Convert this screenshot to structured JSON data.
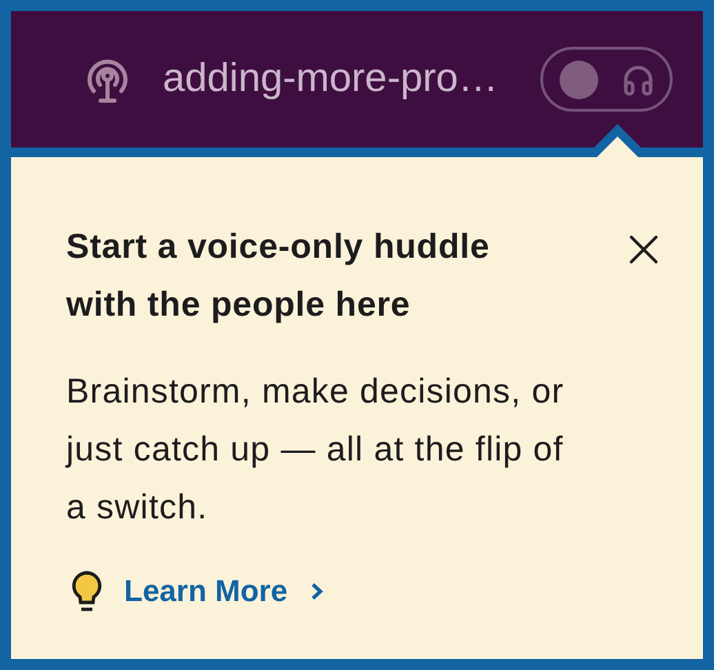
{
  "header": {
    "channel_name": "adding-more-pro…",
    "huddle_toggle": {
      "on": false
    }
  },
  "popover": {
    "title": "Start a voice-only huddle with the people here",
    "body": "Brainstorm, make decisions, or just catch up — all at the flip of a switch.",
    "link": {
      "label": "Learn More"
    }
  }
}
